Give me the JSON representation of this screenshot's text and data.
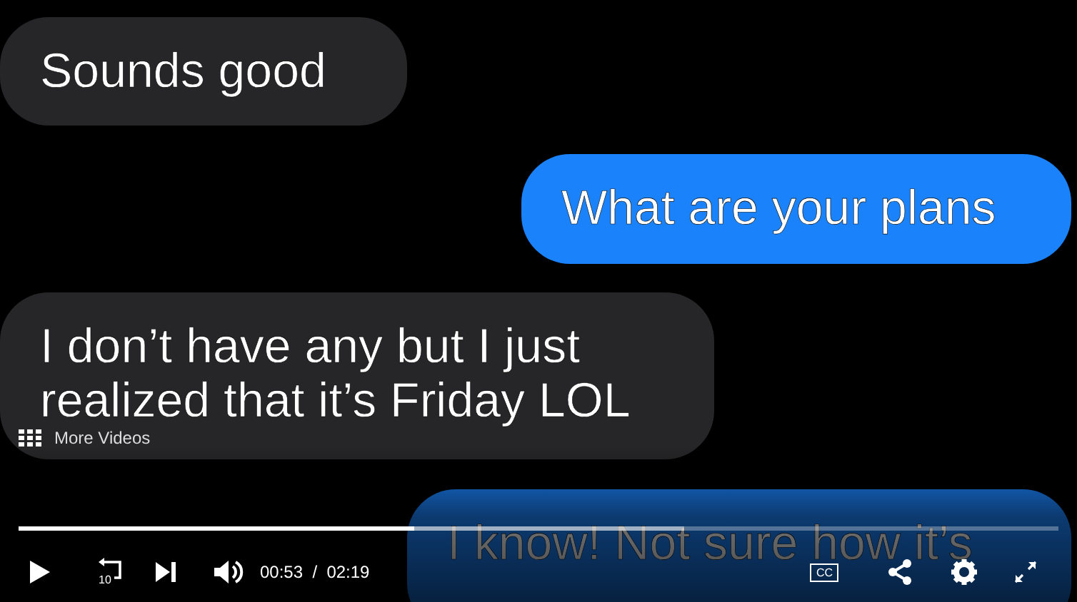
{
  "messages": [
    {
      "kind": "incoming",
      "text": "Sounds good"
    },
    {
      "kind": "outgoing",
      "text": "What are your plans"
    },
    {
      "kind": "incoming",
      "text": "I don’t have any but I just realized that it’s Friday LOL"
    },
    {
      "kind": "outgoing",
      "text": "I know! Not sure how it’s"
    }
  ],
  "more_videos": "More Videos",
  "progress": {
    "level": 0.38,
    "buffered": {
      "level": 0.64
    }
  },
  "controls": {
    "playing": false,
    "rewind_label": "10",
    "captions_label": "CC",
    "current_time": "00:53",
    "separator": "/",
    "duration": "02:19"
  }
}
